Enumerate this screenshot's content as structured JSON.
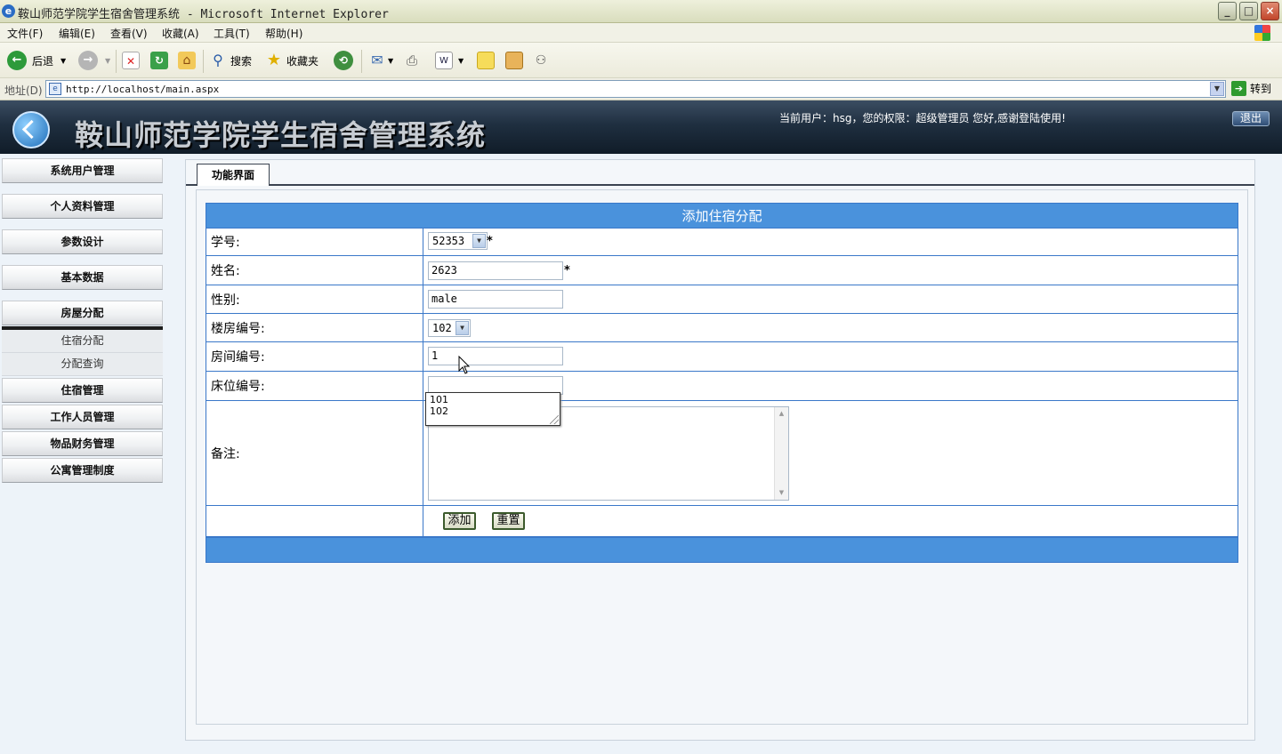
{
  "window": {
    "title": "鞍山师范学院学生宿舍管理系统 - Microsoft Internet Explorer",
    "buttons": [
      "_",
      "□",
      "×"
    ]
  },
  "menu": [
    "文件(F)",
    "编辑(E)",
    "查看(V)",
    "收藏(A)",
    "工具(T)",
    "帮助(H)"
  ],
  "toolbar": {
    "back": "后退",
    "search": "搜索",
    "favorites": "收藏夹"
  },
  "address": {
    "label": "地址(D)",
    "url": "http://localhost/main.aspx",
    "go": "转到"
  },
  "header": {
    "system_name": "鞍山师范学院学生宿舍管理系统",
    "user_info": "当前用户：hsg，您的权限：超级管理员  您好,感谢登陆使用!",
    "logout": "退出"
  },
  "sidebar": {
    "items": [
      "系统用户管理",
      "个人资料管理",
      "参数设计",
      "基本数据",
      "房屋分配"
    ],
    "sub_items": [
      "住宿分配",
      "分配查询"
    ],
    "items_after": [
      "住宿管理",
      "工作人员管理",
      "物品财务管理",
      "公寓管理制度"
    ]
  },
  "tab": "功能界面",
  "form": {
    "title": "添加住宿分配",
    "fields": {
      "student_id": {
        "label": "学号:",
        "value": "52353",
        "required": "*"
      },
      "name": {
        "label": "姓名:",
        "value": "2623",
        "required": "*"
      },
      "gender": {
        "label": "性别:",
        "value": "male"
      },
      "building": {
        "label": "楼房编号:",
        "value": "102"
      },
      "room": {
        "label": "房间编号:",
        "value": "1"
      },
      "bed": {
        "label": "床位编号:",
        "value": ""
      },
      "remark": {
        "label": "备注:",
        "value": ""
      }
    },
    "autocomplete": [
      "101",
      "102"
    ],
    "buttons": {
      "add": "添加",
      "reset": "重置"
    }
  },
  "colors": {
    "header_bar": "#4a92dc",
    "page_background": "#edf3f9",
    "banner": "#1f2f40"
  }
}
